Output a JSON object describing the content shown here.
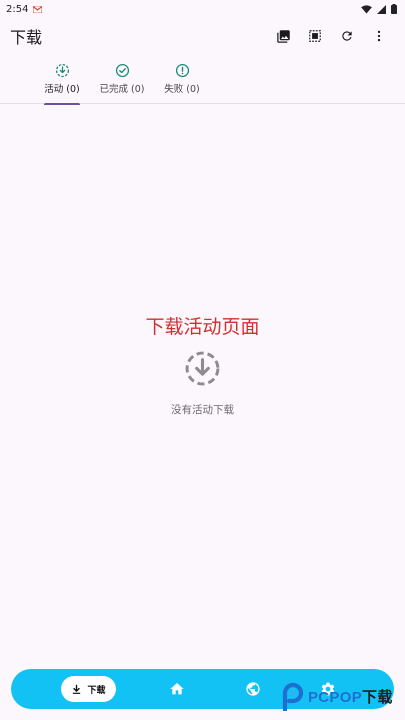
{
  "status_bar": {
    "time": "2:54"
  },
  "app_bar": {
    "title": "下载"
  },
  "tabs": [
    {
      "label": "活动 (0)",
      "active": true
    },
    {
      "label": "已完成 (0)",
      "active": false
    },
    {
      "label": "失败 (0)",
      "active": false
    }
  ],
  "empty_state": {
    "title": "下载活动页面",
    "message": "没有活动下载"
  },
  "bottom_nav": {
    "download_label": "下载"
  },
  "watermark": {
    "brand": "PCPOP",
    "suffix": "下载"
  },
  "colors": {
    "accent": "#6750a4",
    "tab_icon": "#138a72",
    "nav_background": "#12c2f5",
    "title_red": "#d32f2f"
  }
}
